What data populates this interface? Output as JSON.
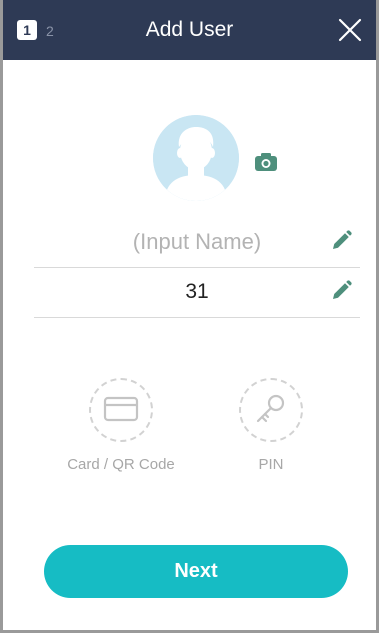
{
  "header": {
    "step_active": "1",
    "step_next": "2",
    "title": "Add User"
  },
  "profile": {
    "name_placeholder": "(Input Name)",
    "user_id": "31"
  },
  "auth_methods": {
    "card_label": "Card / QR Code",
    "pin_label": "PIN"
  },
  "actions": {
    "next_label": "Next"
  },
  "icons": {
    "close": "close-icon",
    "camera": "camera-icon",
    "edit": "pencil-icon",
    "card": "card-icon",
    "key": "key-icon"
  },
  "colors": {
    "header_bg": "#2e3a55",
    "accent": "#16bcc4",
    "icon_green": "#4e8f7c",
    "avatar_bg": "#c9e6f3"
  }
}
